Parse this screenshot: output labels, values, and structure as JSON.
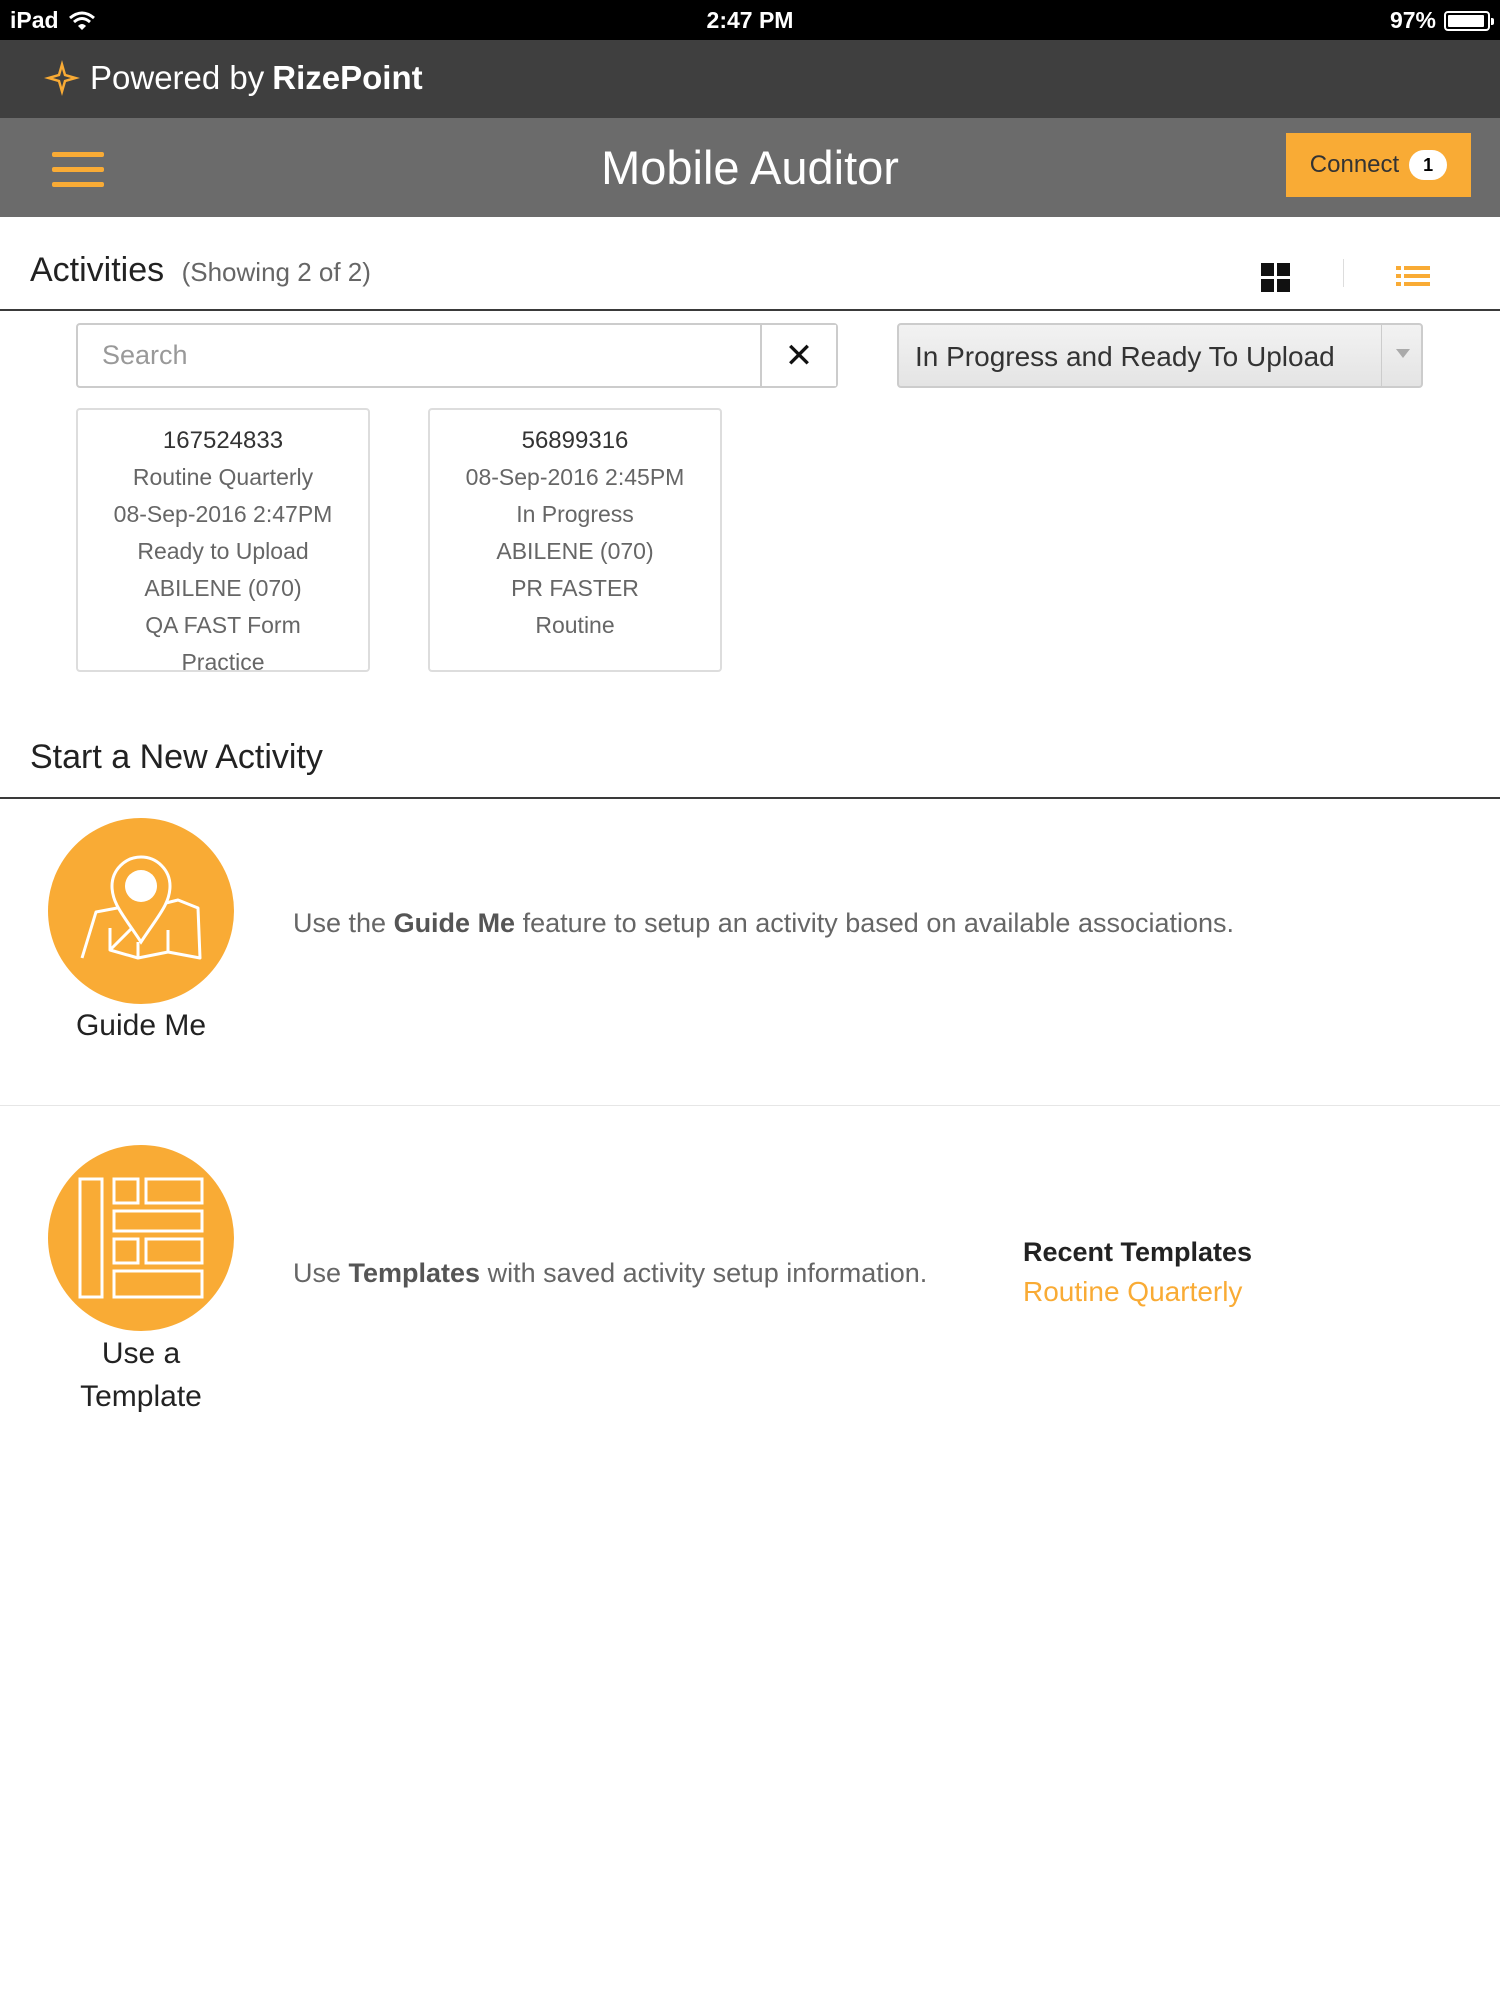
{
  "status_bar": {
    "device": "iPad",
    "time": "2:47 PM",
    "battery": "97%"
  },
  "powered_bar": {
    "prefix": "Powered by",
    "brand": "RizePoint"
  },
  "header": {
    "title": "Mobile Auditor",
    "connect_label": "Connect",
    "connect_count": "1"
  },
  "activities": {
    "title": "Activities",
    "count": "(Showing 2 of 2)",
    "search": {
      "placeholder": "Search",
      "value": ""
    },
    "filter": {
      "selected": "In Progress and Ready To Upload"
    },
    "cards": [
      {
        "id": "167524833",
        "lines": [
          "Routine Quarterly",
          "08-Sep-2016 2:47PM",
          "Ready to Upload",
          "ABILENE (070)",
          "QA FAST Form",
          "Practice"
        ]
      },
      {
        "id": "56899316",
        "lines": [
          "08-Sep-2016 2:45PM",
          "In Progress",
          "ABILENE (070)",
          "PR FASTER",
          "Routine"
        ]
      }
    ]
  },
  "start_new": {
    "title": "Start a New Activity",
    "guide": {
      "label": "Guide Me",
      "desc_pre": "Use the ",
      "desc_bold": "Guide Me",
      "desc_post": " feature to setup an activity based on available associations."
    },
    "template": {
      "label_line1": "Use a",
      "label_line2": "Template",
      "desc_pre": "Use ",
      "desc_bold": "Templates",
      "desc_post": " with saved activity setup information.",
      "recent_title": "Recent Templates",
      "recent_items": [
        "Routine Quarterly"
      ]
    }
  },
  "colors": {
    "accent": "#f9ab35",
    "header_bg": "#6b6b6b",
    "powered_bg": "#3f3f3f"
  },
  "icons": [
    "wifi-icon",
    "battery-icon",
    "rizepoint-logo-icon",
    "hamburger-menu-icon",
    "grid-view-icon",
    "list-view-icon",
    "close-icon",
    "chevron-down-icon",
    "map-pin-icon",
    "template-icon"
  ]
}
